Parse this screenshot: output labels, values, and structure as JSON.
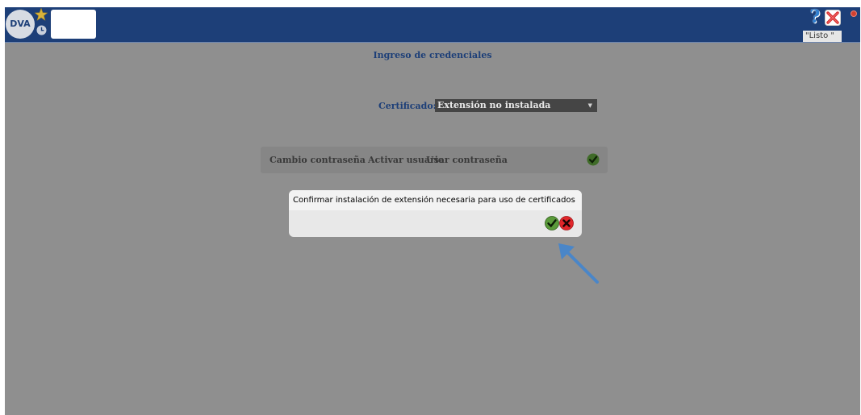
{
  "header": {
    "logo_text": "DVA",
    "status_text": "\"Listo \"",
    "help_symbol": "?",
    "icons": [
      "star-icon",
      "clock-icon",
      "help-icon",
      "close-icon",
      "alert-icon"
    ]
  },
  "main": {
    "title": "Ingreso de credenciales",
    "certificate_label": "Certificado:",
    "certificate_value": "Extensión no instalada",
    "options": [
      {
        "label": "Cambio contraseña"
      },
      {
        "label": "Activar usuario"
      },
      {
        "label": "Usar contraseña"
      }
    ]
  },
  "dialog": {
    "message": "Confirmar instalación de extensión necesaria para uso de certificados",
    "confirm_icon": "check-icon",
    "cancel_icon": "cancel-icon"
  },
  "colors": {
    "header_bg": "#1d3f78",
    "overlay_bg": "#8f8f8f",
    "accent_text": "#1d3f78",
    "annotation_arrow": "#4a86c8"
  }
}
